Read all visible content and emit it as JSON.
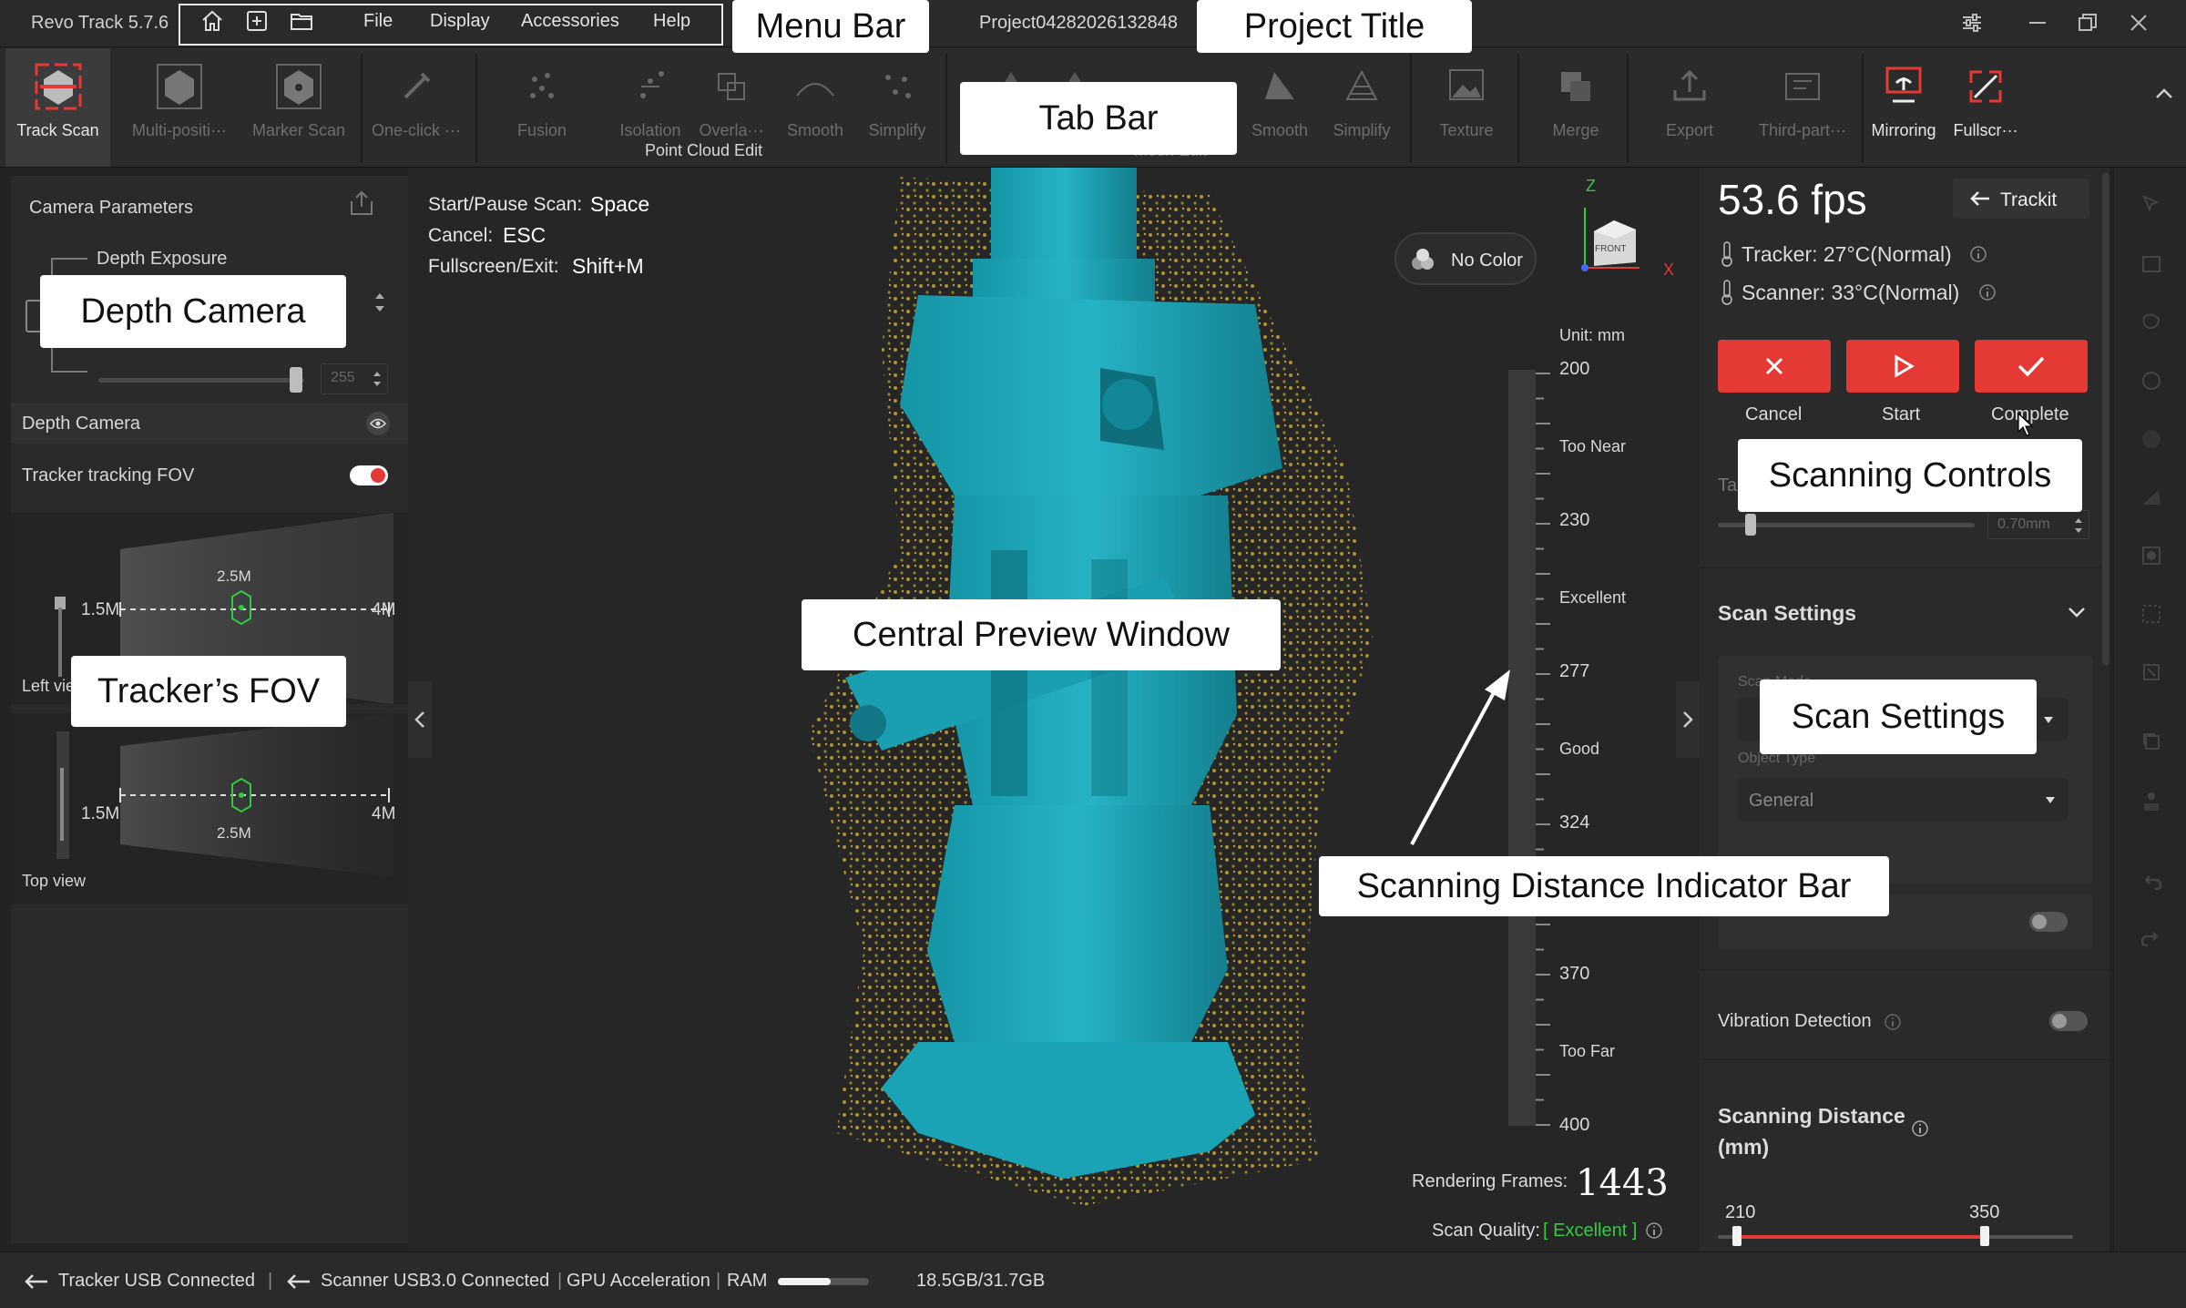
{
  "app": {
    "name": "Revo Track 5.7.6",
    "project_title": "Project04282026132848"
  },
  "menu": {
    "items": [
      "File",
      "Display",
      "Accessories",
      "Help"
    ]
  },
  "toolbar": {
    "tools": [
      {
        "label": "Track Scan",
        "icon": "track-scan-icon"
      },
      {
        "label": "Multi-positi···",
        "icon": "multi-position-icon"
      },
      {
        "label": "Marker Scan",
        "icon": "marker-scan-icon"
      },
      {
        "label": "One-click ···",
        "icon": "one-click-icon"
      },
      {
        "label": "Fusion",
        "icon": "fusion-icon"
      },
      {
        "label": "Isolation",
        "icon": "isolation-icon"
      },
      {
        "label": "Overla···",
        "icon": "overlap-icon"
      },
      {
        "label": "Smooth",
        "icon": "smooth-icon"
      },
      {
        "label": "Simplify",
        "icon": "simplify-icon"
      },
      {
        "label": "Smooth",
        "icon": "mesh-smooth-icon"
      },
      {
        "label": "Simplify",
        "icon": "mesh-simplify-icon"
      },
      {
        "label": "Texture",
        "icon": "texture-icon"
      },
      {
        "label": "Merge",
        "icon": "merge-icon"
      },
      {
        "label": "Export",
        "icon": "export-icon"
      },
      {
        "label": "Third-part···",
        "icon": "third-party-icon"
      },
      {
        "label": "Mirroring",
        "icon": "mirroring-icon"
      },
      {
        "label": "Fullscr···",
        "icon": "fullscreen-icon"
      }
    ],
    "group_point_cloud": "Point Cloud Edit",
    "group_mesh": "Mesh Edit"
  },
  "callouts": {
    "menu_bar": "Menu Bar",
    "project_title": "Project Title",
    "tab_bar": "Tab Bar",
    "depth_camera": "Depth Camera",
    "trackers_fov": "Tracker’s FOV",
    "central_preview": "Central Preview Window",
    "scanning_controls": "Scanning Controls",
    "scan_settings": "Scan Settings",
    "distance_indicator": "Scanning Distance Indicator Bar"
  },
  "left_panel": {
    "title": "Camera Parameters",
    "depth_exposure": "Depth Exposure",
    "slider_value": "255",
    "depth_camera": "Depth Camera",
    "tracker_fov_label": "Tracker tracking FOV",
    "tracker_fov_on": true,
    "fov_near": "1.5M",
    "fov_mid": "2.5M",
    "fov_far": "4M",
    "left_view": "Left vie",
    "top_view": "Top view"
  },
  "viewport": {
    "shortcuts": [
      {
        "key": "Start/Pause Scan:",
        "value": "Space"
      },
      {
        "key": "Cancel:",
        "value": "ESC"
      },
      {
        "key": "Fullscreen/Exit:",
        "value": "Shift+M"
      }
    ],
    "no_color": "No Color",
    "axis_front": "FRONT",
    "axis_z": "Z",
    "axis_x": "X",
    "unit": "Unit: mm",
    "distance_marks": [
      "200",
      "Too Near",
      "230",
      "Excellent",
      "277",
      "Good",
      "324",
      "370",
      "Too Far",
      "400"
    ],
    "rendering_frames_label": "Rendering Frames:",
    "rendering_frames": "1443",
    "scan_quality_label": "Scan Quality:",
    "scan_quality": "[ Excellent ]",
    "colors": {
      "mesh": "#1aa3b5",
      "points": "#c8a628",
      "quality": "#2ecc40"
    }
  },
  "right_panel": {
    "fps": "53.6 fps",
    "trackit": "Trackit",
    "tracker_temp": "Tracker: 27°C(Normal)",
    "scanner_temp": "Scanner: 33°C(Normal)",
    "cancel": "Cancel",
    "start": "Start",
    "complete": "Complete",
    "resolution_label": "Ta",
    "resolution_value": "0.70mm",
    "scan_settings": "Scan Settings",
    "scan_mode_label": "Scan Mode",
    "object_type_label": "Object Type",
    "object_type_value": "General",
    "vibration_detection": "Vibration Detection",
    "scanning_distance": "Scanning Distance",
    "scanning_distance_unit": "(mm)",
    "distance_min": "210",
    "distance_max": "350",
    "accent": "#e53935"
  },
  "status": {
    "tracker": "Tracker USB Connected",
    "scanner": "Scanner USB3.0 Connected",
    "gpu": "GPU Acceleration",
    "ram_label": "RAM",
    "ram_value": "18.5GB/31.7GB",
    "ram_fraction": 0.58
  }
}
